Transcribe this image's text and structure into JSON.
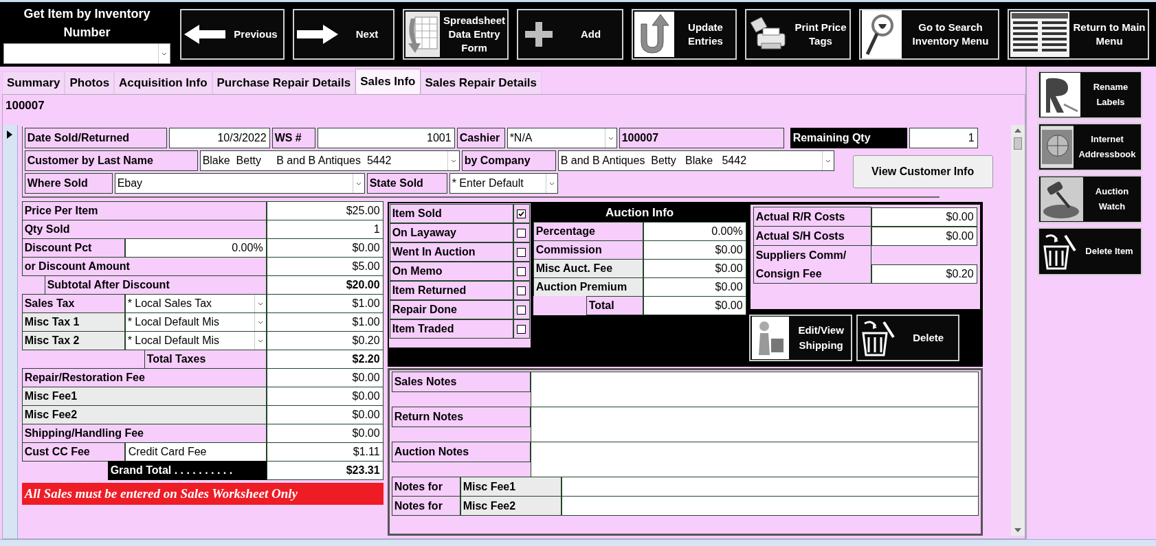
{
  "lookup": {
    "title": "Get Item by Inventory Number"
  },
  "toolbar": [
    {
      "kind": "previous",
      "label": "Previous"
    },
    {
      "kind": "next",
      "label": "Next"
    },
    {
      "kind": "spreadsheet",
      "label": "Spreadsheet Data Entry Form"
    },
    {
      "kind": "add",
      "label": "Add"
    },
    {
      "kind": "update",
      "label": "Update Entries"
    },
    {
      "kind": "print",
      "label": "Print Price Tags"
    },
    {
      "kind": "search",
      "label": "Go to Search Inventory Menu"
    },
    {
      "kind": "menu",
      "label": "Return to Main Menu"
    }
  ],
  "tabs": [
    {
      "label": "Summary",
      "selected": false
    },
    {
      "label": "Photos",
      "selected": false
    },
    {
      "label": "Acquisition Info",
      "selected": false
    },
    {
      "label": "Purchase Repair Details",
      "selected": false
    },
    {
      "label": "Sales Info",
      "selected": true
    },
    {
      "label": "Sales Repair Details",
      "selected": false
    }
  ],
  "record_id": "100007",
  "header_rows": [
    [
      {
        "kind": "label",
        "text": "Date Sold/Returned"
      },
      {
        "kind": "value",
        "text": "10/3/2022"
      },
      {
        "kind": "label",
        "text": "WS #"
      },
      {
        "kind": "value",
        "text": "1001"
      },
      {
        "kind": "label",
        "text": "Cashier"
      },
      {
        "kind": "combo",
        "text": "*N/A"
      },
      {
        "kind": "id",
        "text": "100007"
      },
      {
        "kind": "dark",
        "text": "Remaining Qty"
      },
      {
        "kind": "value",
        "text": "1"
      }
    ],
    [
      {
        "kind": "label",
        "text": "Customer by Last Name"
      },
      {
        "kind": "combo",
        "text": "Blake  Betty     B and B Antiques  5442"
      },
      {
        "kind": "label",
        "text": "by Company"
      },
      {
        "kind": "combo",
        "text": "B and B Antiques  Betty   Blake   5442"
      }
    ],
    [
      {
        "kind": "label",
        "text": "Where Sold"
      },
      {
        "kind": "combo",
        "text": "Ebay"
      },
      {
        "kind": "label",
        "text": "State Sold"
      },
      {
        "kind": "combo",
        "text": "* Enter Default"
      }
    ]
  ],
  "view_customer_button": "View Customer Info",
  "pricing_rows": [
    [
      {
        "kind": "label",
        "text": "Price Per Item"
      },
      {
        "kind": "value",
        "text": "$25.00"
      }
    ],
    [
      {
        "kind": "label",
        "text": "Qty Sold"
      },
      {
        "kind": "value",
        "text": "1"
      }
    ],
    [
      {
        "kind": "label",
        "text": "Discount Pct"
      },
      {
        "kind": "value",
        "text": "0.00%"
      },
      {
        "kind": "value",
        "text": "$0.00"
      }
    ],
    [
      {
        "kind": "label",
        "text": "or Discount Amount"
      },
      {
        "kind": "value",
        "text": "$5.00"
      }
    ],
    [
      {
        "kind": "indent",
        "text": "Subtotal After Discount"
      },
      {
        "kind": "bold-value",
        "text": "$20.00"
      }
    ],
    [
      {
        "kind": "label",
        "text": "Sales Tax"
      },
      {
        "kind": "combo",
        "text": "* Local Sales Tax"
      },
      {
        "kind": "value",
        "text": "$1.00"
      }
    ],
    [
      {
        "kind": "grey",
        "text": "Misc Tax 1"
      },
      {
        "kind": "combo",
        "text": "* Local Default Mis"
      },
      {
        "kind": "value",
        "text": "$1.00"
      }
    ],
    [
      {
        "kind": "grey",
        "text": "Misc Tax 2"
      },
      {
        "kind": "combo",
        "text": "* Local Default Mis"
      },
      {
        "kind": "value",
        "text": "$0.20"
      }
    ],
    [
      {
        "kind": "total",
        "text": "Total Taxes"
      },
      {
        "kind": "bold-value",
        "text": "$2.20"
      }
    ],
    [
      {
        "kind": "label",
        "text": "Repair/Restoration Fee"
      },
      {
        "kind": "value",
        "text": "$0.00"
      }
    ],
    [
      {
        "kind": "grey",
        "text": "Misc Fee1"
      },
      {
        "kind": "value",
        "text": "$0.00"
      }
    ],
    [
      {
        "kind": "grey",
        "text": "Misc Fee2"
      },
      {
        "kind": "value",
        "text": "$0.00"
      }
    ],
    [
      {
        "kind": "label",
        "text": "Shipping/Handling Fee"
      },
      {
        "kind": "value",
        "text": "$0.00"
      }
    ],
    [
      {
        "kind": "label",
        "text": "Cust CC Fee"
      },
      {
        "kind": "text",
        "text": "Credit Card Fee"
      },
      {
        "kind": "value",
        "text": "$1.11"
      }
    ],
    [
      {
        "kind": "dark",
        "text": "Grand Total . . . . . . . . . ."
      },
      {
        "kind": "bold-value",
        "text": "$23.31"
      }
    ]
  ],
  "warning": "All Sales must be entered on Sales Worksheet Only",
  "status_checks": [
    {
      "label": "Item Sold",
      "checked": true
    },
    {
      "label": "On Layaway",
      "checked": false
    },
    {
      "label": "Went In Auction",
      "checked": false
    },
    {
      "label": "On Memo",
      "checked": false
    },
    {
      "label": "Item Returned",
      "checked": false
    },
    {
      "label": "Repair Done",
      "checked": false
    },
    {
      "label": "Item Traded",
      "checked": false
    }
  ],
  "auction": {
    "title": "Auction Info",
    "rows": [
      {
        "kind": "label",
        "label": "Percentage",
        "value": "0.00%"
      },
      {
        "kind": "label",
        "label": "Commission",
        "value": "$0.00"
      },
      {
        "kind": "grey",
        "label": "Misc Auct. Fee",
        "value": "$0.00"
      },
      {
        "kind": "grey",
        "label": "Auction Premium",
        "value": "$0.00"
      },
      {
        "kind": "total",
        "label": "Total",
        "value": "$0.00"
      }
    ]
  },
  "costs": [
    {
      "label": "Actual R/R Costs",
      "value": "$0.00"
    },
    {
      "label": "Actual S/H Costs",
      "value": "$0.00"
    },
    {
      "label": "Suppliers Comm/ Consign Fee",
      "value": "$0.20"
    }
  ],
  "actions": [
    {
      "kind": "shipping",
      "label": "Edit/View Shipping"
    },
    {
      "kind": "delete",
      "label": "Delete"
    }
  ],
  "notes": [
    {
      "label": "Sales Notes"
    },
    {
      "label": "Return Notes"
    },
    {
      "label": "Auction Notes"
    }
  ],
  "fee_notes": [
    {
      "label": "Notes for",
      "fee": "Misc Fee1"
    },
    {
      "label": "Notes for",
      "fee": "Misc Fee2"
    }
  ],
  "side_buttons": [
    {
      "kind": "rename",
      "label": "Rename Labels"
    },
    {
      "kind": "addressbook",
      "label": "Internet Addressbook"
    },
    {
      "kind": "watch",
      "label": "Auction Watch"
    },
    {
      "kind": "delete",
      "label": "Delete Item"
    }
  ]
}
